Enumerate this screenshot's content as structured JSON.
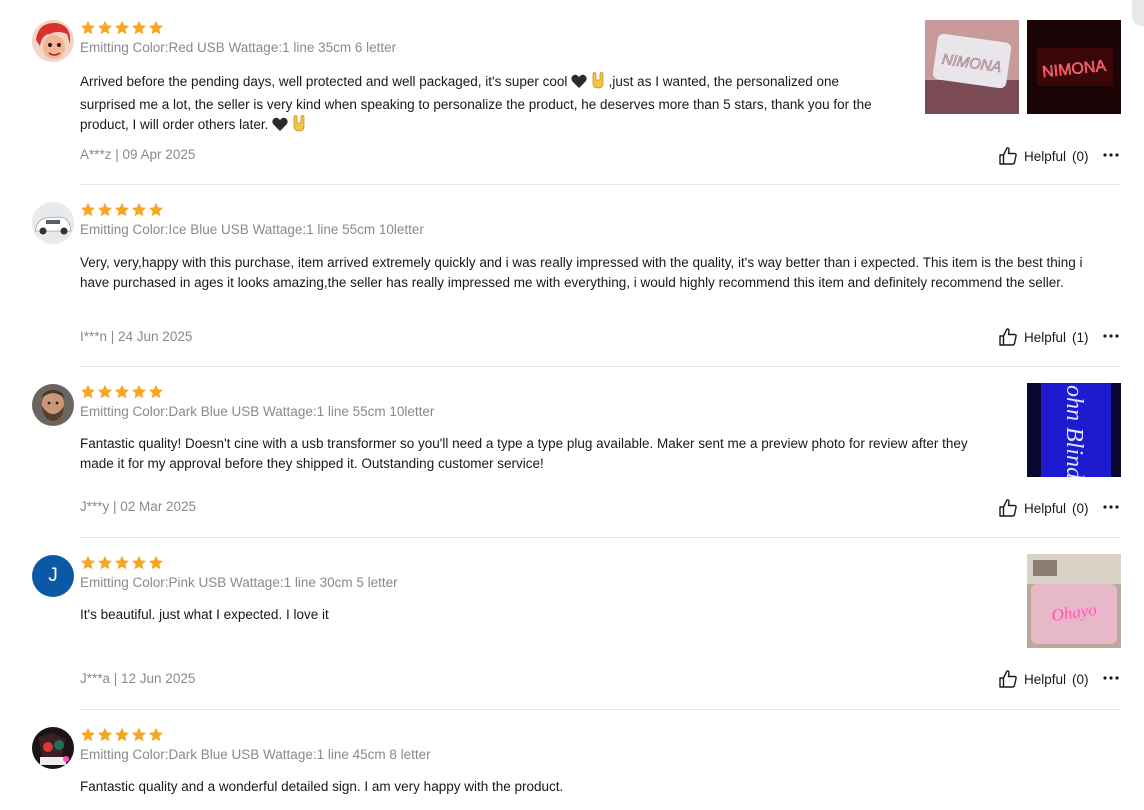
{
  "helpful_label": "Helpful",
  "colors": {
    "star": "#f5a623",
    "muted": "#8a8a8a",
    "text": "#191919",
    "divider": "#e5e5e5"
  },
  "reviews": [
    {
      "rating": 5,
      "variant": "Emitting Color:Red USB Wattage:1 line 35cm 6 letter",
      "text_1": "Arrived before the pending days, well protected and well packaged, it's super cool",
      "text_2": ",just as I wanted, the personalized one surprised me a lot, the seller is very kind when speaking to personalize the product, he deserves more than 5 stars, thank you for the product, I will order others later.",
      "emoji": [
        "black-heart",
        "rock-on-hand"
      ],
      "meta": "A***z | 09 Apr 2025",
      "helpful_count": "(0)",
      "photo_text": [
        "NIMONA",
        "NIMONA"
      ]
    },
    {
      "rating": 5,
      "variant": "Emitting Color:Ice Blue USB Wattage:1 line 55cm 10letter",
      "text": "Very, very,happy with this purchase, item arrived extremely quickly and i was really impressed with the quality, it's way better than i expected. This item is the best thing i have purchased in ages it looks amazing,the seller has really impressed me with everything, i would highly recommend this item and definitely recommend the seller.",
      "meta": "I***n | 24 Jun 2025",
      "helpful_count": "(1)"
    },
    {
      "rating": 5,
      "variant": "Emitting Color:Dark Blue USB Wattage:1 line 55cm 10letter",
      "text": "Fantastic quality! Doesn't cine with a usb transformer so you'll need a type a type plug available. Maker sent me a preview photo for review after they made it for my approval before they shipped it. Outstanding customer service!",
      "meta": "J***y | 02 Mar 2025",
      "helpful_count": "(0)",
      "photo_text": "ohn Blind"
    },
    {
      "rating": 5,
      "avatar_letter": "J",
      "variant": "Emitting Color:Pink USB Wattage:1 line 30cm 5 letter",
      "text": "It's beautiful. just what I expected. I love it",
      "meta": "J***a | 12 Jun 2025",
      "helpful_count": "(0)",
      "photo_text": "Ohayo"
    },
    {
      "rating": 5,
      "variant": "Emitting Color:Dark Blue USB Wattage:1 line 45cm 8 letter",
      "text": "Fantastic quality and a wonderful detailed sign. I am very happy with the product."
    }
  ]
}
